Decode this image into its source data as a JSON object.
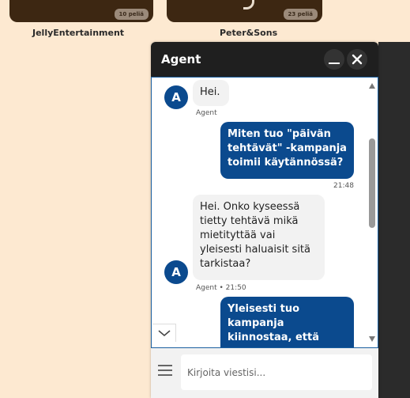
{
  "games": [
    {
      "publisher": "JellyEntertainment",
      "count": "10 peliä"
    },
    {
      "publisher": "Peter&Sons",
      "count": "23 peliä"
    }
  ],
  "chat": {
    "title": "Agent",
    "messages": [
      {
        "sender": "agent",
        "avatar": "A",
        "text": "Hei.",
        "meta": "Agent"
      },
      {
        "sender": "user",
        "text": "Miten tuo \"päivän tehtävät\" -kampanja toimii käytännössä?",
        "time": "21:48"
      },
      {
        "sender": "agent",
        "avatar": "A",
        "text": "Hei. Onko kyseessä tietty tehtävä mikä mietityttää vai yleisesti haluaisit sitä tarkistaa?",
        "meta": "Agent • 21:50"
      },
      {
        "sender": "user",
        "text": "Yleisesti tuo kampanja kiinnostaa, että"
      }
    ],
    "input_placeholder": "Kirjoita viestisi..."
  },
  "colors": {
    "page_bg": "#fde9d1",
    "header_bg": "#1f1f1f",
    "user_bubble": "#0b4a8e",
    "agent_bubble": "#f2f2f2"
  }
}
